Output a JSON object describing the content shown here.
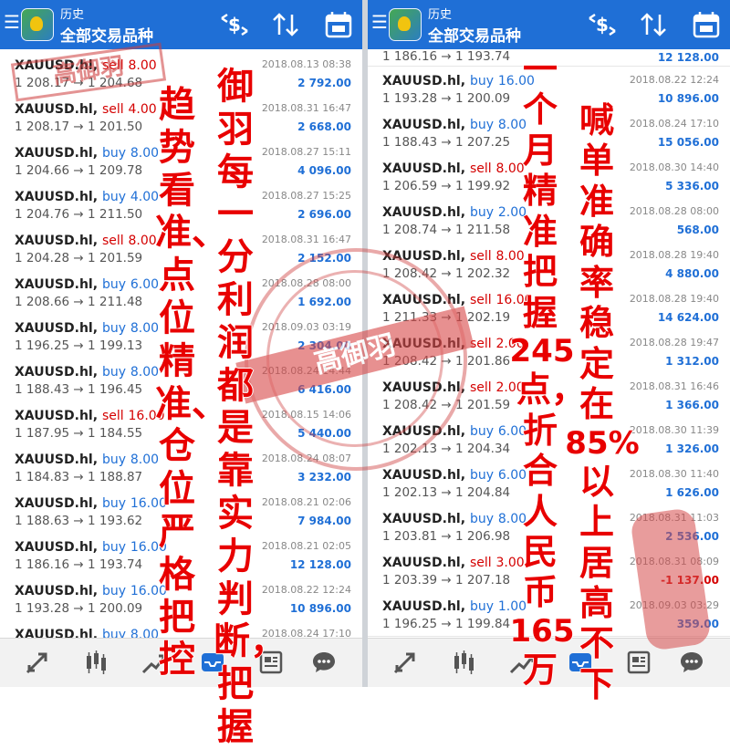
{
  "header": {
    "small": "历史",
    "title": "全部交易品种"
  },
  "icons": {
    "header": [
      "menu-icon",
      "app-logo-icon",
      "currency-exchange-icon",
      "sort-icon",
      "calendar-icon"
    ],
    "bottom_nav": [
      "trade-arrows-icon",
      "candlestick-icon",
      "trend-line-icon",
      "inbox-icon",
      "news-icon",
      "chat-icon"
    ]
  },
  "colors": {
    "header_bg": "#1f6fd6",
    "buy": "#1f6fd6",
    "sell": "#d40000",
    "overlay_text": "#e80000"
  },
  "left_list": [
    {
      "symbol": "XAUUSD.hl",
      "side": "sell",
      "lot": "8.00",
      "open": "1 208.17",
      "close": "1 204.68",
      "date": "2018.08.13 08:38",
      "profit": "2 792.00"
    },
    {
      "symbol": "XAUUSD.hl",
      "side": "sell",
      "lot": "4.00",
      "open": "1 208.17",
      "close": "1 201.50",
      "date": "2018.08.31 16:47",
      "profit": "2 668.00"
    },
    {
      "symbol": "XAUUSD.hl",
      "side": "buy",
      "lot": "8.00",
      "open": "1 204.66",
      "close": "1 209.78",
      "date": "2018.08.27 15:11",
      "profit": "4 096.00"
    },
    {
      "symbol": "XAUUSD.hl",
      "side": "buy",
      "lot": "4.00",
      "open": "1 204.76",
      "close": "1 211.50",
      "date": "2018.08.27 15:25",
      "profit": "2 696.00"
    },
    {
      "symbol": "XAUUSD.hl",
      "side": "sell",
      "lot": "8.00",
      "open": "1 204.28",
      "close": "1 201.59",
      "date": "2018.08.31 16:47",
      "profit": "2 152.00"
    },
    {
      "symbol": "XAUUSD.hl",
      "side": "buy",
      "lot": "6.00",
      "open": "1 208.66",
      "close": "1 211.48",
      "date": "2018.08.28 08:00",
      "profit": "1 692.00"
    },
    {
      "symbol": "XAUUSD.hl",
      "side": "buy",
      "lot": "8.00",
      "open": "1 196.25",
      "close": "1 199.13",
      "date": "2018.09.03 03:19",
      "profit": "2 304.00"
    },
    {
      "symbol": "XAUUSD.hl",
      "side": "buy",
      "lot": "8.00",
      "open": "1 188.43",
      "close": "1 196.45",
      "date": "2018.08.24 14:44",
      "profit": "6 416.00"
    },
    {
      "symbol": "XAUUSD.hl",
      "side": "sell",
      "lot": "16.00",
      "open": "1 187.95",
      "close": "1 184.55",
      "date": "2018.08.15 14:06",
      "profit": "5 440.00"
    },
    {
      "symbol": "XAUUSD.hl",
      "side": "buy",
      "lot": "8.00",
      "open": "1 184.83",
      "close": "1 188.87",
      "date": "2018.08.24 08:07",
      "profit": "3 232.00"
    },
    {
      "symbol": "XAUUSD.hl",
      "side": "buy",
      "lot": "16.00",
      "open": "1 188.63",
      "close": "1 193.62",
      "date": "2018.08.21 02:06",
      "profit": "7 984.00"
    },
    {
      "symbol": "XAUUSD.hl",
      "side": "buy",
      "lot": "16.00",
      "open": "1 186.16",
      "close": "1 193.74",
      "date": "2018.08.21 02:05",
      "profit": "12 128.00"
    },
    {
      "symbol": "XAUUSD.hl",
      "side": "buy",
      "lot": "16.00",
      "open": "1 193.28",
      "close": "1 200.09",
      "date": "2018.08.22 12:24",
      "profit": "10 896.00"
    },
    {
      "symbol": "XAUUSD.hl",
      "side": "buy",
      "lot": "8.00",
      "open": "",
      "close": "",
      "date": "2018.08.24 17:10",
      "profit": ""
    }
  ],
  "right_partial": {
    "open": "1 186.16",
    "close": "1 193.74",
    "profit": "12 128.00"
  },
  "right_list": [
    {
      "symbol": "XAUUSD.hl",
      "side": "buy",
      "lot": "16.00",
      "open": "1 193.28",
      "close": "1 200.09",
      "date": "2018.08.22 12:24",
      "profit": "10 896.00"
    },
    {
      "symbol": "XAUUSD.hl",
      "side": "buy",
      "lot": "8.00",
      "open": "1 188.43",
      "close": "1 207.25",
      "date": "2018.08.24 17:10",
      "profit": "15 056.00"
    },
    {
      "symbol": "XAUUSD.hl",
      "side": "sell",
      "lot": "8.00",
      "open": "1 206.59",
      "close": "1 199.92",
      "date": "2018.08.30 14:40",
      "profit": "5 336.00"
    },
    {
      "symbol": "XAUUSD.hl",
      "side": "buy",
      "lot": "2.00",
      "open": "1 208.74",
      "close": "1 211.58",
      "date": "2018.08.28 08:00",
      "profit": "568.00"
    },
    {
      "symbol": "XAUUSD.hl",
      "side": "sell",
      "lot": "8.00",
      "open": "1 208.42",
      "close": "1 202.32",
      "date": "2018.08.28 19:40",
      "profit": "4 880.00"
    },
    {
      "symbol": "XAUUSD.hl",
      "side": "sell",
      "lot": "16.00",
      "open": "1 211.33",
      "close": "1 202.19",
      "date": "2018.08.28 19:40",
      "profit": "14 624.00"
    },
    {
      "symbol": "XAUUSD.hl",
      "side": "sell",
      "lot": "2.00",
      "open": "1 208.42",
      "close": "1 201.86",
      "date": "2018.08.28 19:47",
      "profit": "1 312.00"
    },
    {
      "symbol": "XAUUSD.hl",
      "side": "sell",
      "lot": "2.00",
      "open": "1 208.42",
      "close": "1 201.59",
      "date": "2018.08.31 16:46",
      "profit": "1 366.00"
    },
    {
      "symbol": "XAUUSD.hl",
      "side": "buy",
      "lot": "6.00",
      "open": "1 202.13",
      "close": "1 204.34",
      "date": "2018.08.30 11:39",
      "profit": "1 326.00"
    },
    {
      "symbol": "XAUUSD.hl",
      "side": "buy",
      "lot": "6.00",
      "open": "1 202.13",
      "close": "1 204.84",
      "date": "2018.08.30 11:40",
      "profit": "1 626.00"
    },
    {
      "symbol": "XAUUSD.hl",
      "side": "buy",
      "lot": "8.00",
      "open": "1 203.81",
      "close": "1 206.98",
      "date": "2018.08.31 11:03",
      "profit": "2 536.00"
    },
    {
      "symbol": "XAUUSD.hl",
      "side": "sell",
      "lot": "3.00",
      "open": "1 203.39",
      "close": "1 207.18",
      "date": "2018.08.31 08:09",
      "profit": "-1 137.00"
    },
    {
      "symbol": "XAUUSD.hl",
      "side": "buy",
      "lot": "1.00",
      "open": "1 196.25",
      "close": "1 199.84",
      "date": "2018.09.03 03:29",
      "profit": "359.00"
    }
  ],
  "overlay": {
    "col1": "趋势看准、点位精准、仓位严格把控",
    "col2": "御羽每一分利润都是靠实力判断，把握",
    "col3_a": "一个月精准把握",
    "col3_num": "245",
    "col3_b": "点，折合人民币",
    "col3_num2": "165",
    "col3_c": "万",
    "col4_a": "喊单准确率稳定在",
    "col4_pct": "85%",
    "col4_b": "以上居高不下"
  },
  "stamp_text": "高御羽",
  "watermark_text": "高御羽"
}
